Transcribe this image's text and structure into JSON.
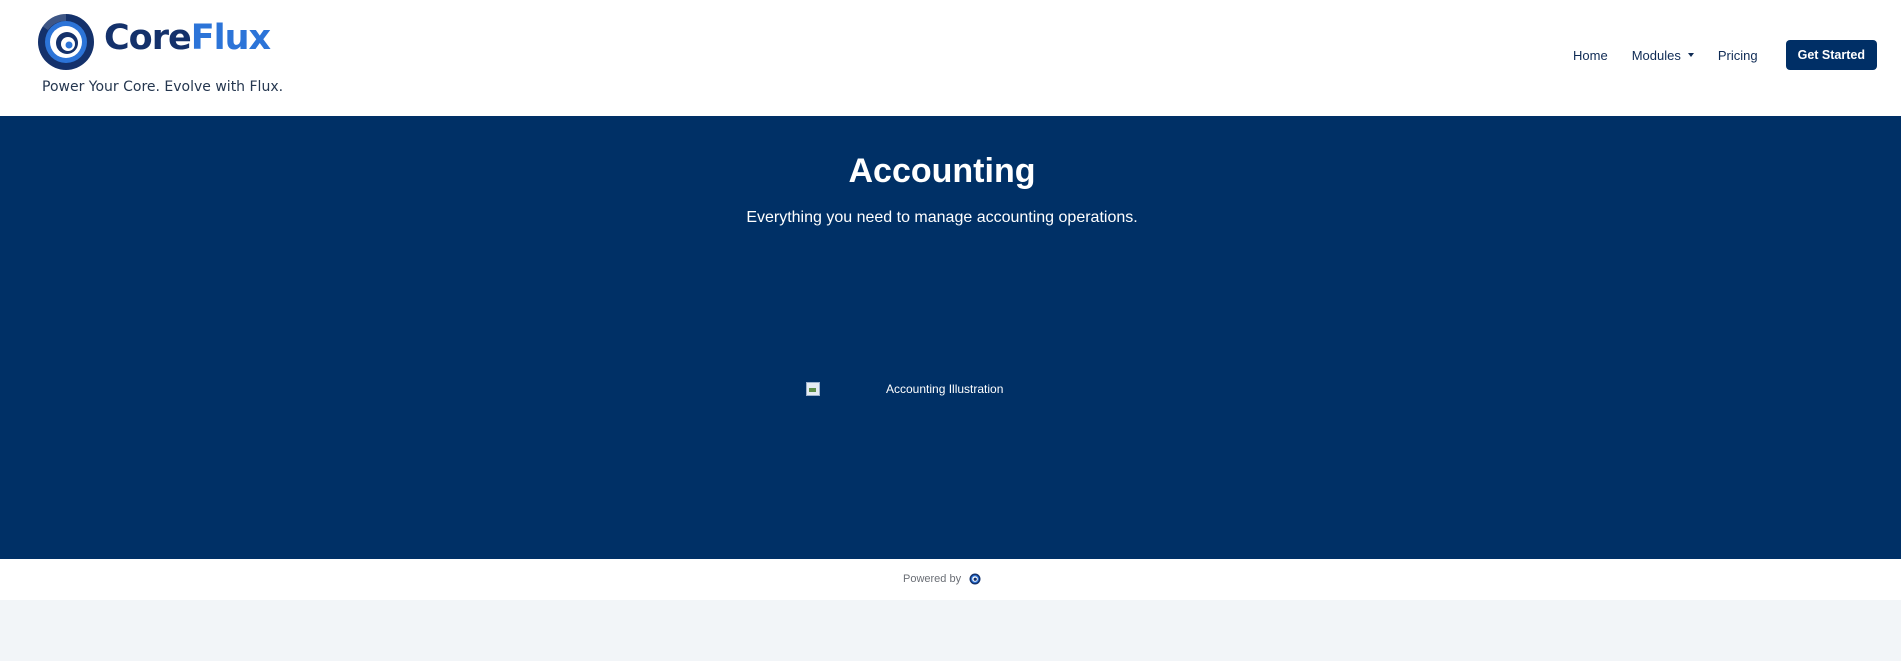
{
  "header": {
    "logo_core": "Core",
    "logo_flux": "Flux",
    "tagline": "Power Your Core. Evolve with Flux.",
    "nav": {
      "home": "Home",
      "modules": "Modules",
      "pricing": "Pricing",
      "cta": "Get Started"
    }
  },
  "hero": {
    "title": "Accounting",
    "subtitle": "Everything you need to manage accounting operations.",
    "image_alt": "Accounting Illustration"
  },
  "footer": {
    "powered_by": "Powered by"
  },
  "colors": {
    "brand_navy": "#003066",
    "brand_blue": "#2c74d8",
    "background": "#f2f5f8"
  }
}
